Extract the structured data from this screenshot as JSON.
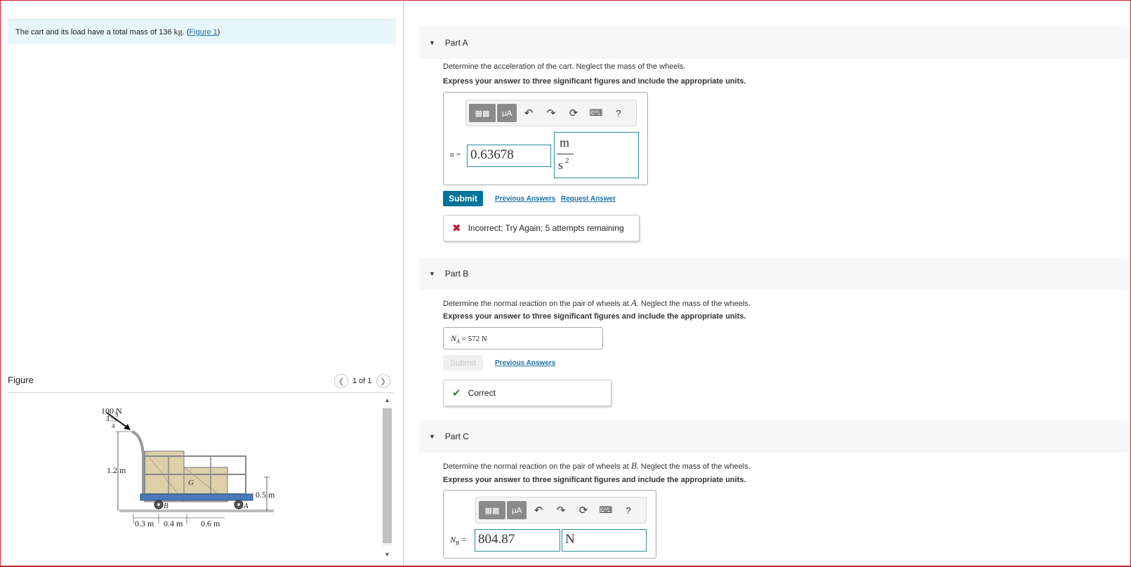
{
  "problem": {
    "text_before": "The cart and its load have a total mass of 136",
    "mass_unit": "kg",
    "text_after": ". (",
    "figure_link": "Figure 1",
    "text_end": ")"
  },
  "figure": {
    "label": "Figure",
    "pager": "1 of 1",
    "prev_icon": "chevron-left-icon",
    "next_icon": "chevron-right-icon",
    "labels": {
      "force": "100 N",
      "slope_3": "3",
      "slope_4": "4",
      "slope_5": "5",
      "height": "1.2 m",
      "wheel_height": "0.5 m",
      "point_g": "G",
      "point_b": "B",
      "point_a": "A",
      "dim_1": "0.3 m",
      "dim_2": "0.4 m",
      "dim_3": "0.6 m"
    }
  },
  "toolbar": {
    "template_icon": "template-icon",
    "units_label": "μA",
    "undo_icon": "undo-icon",
    "redo_icon": "redo-icon",
    "reset_icon": "reset-icon",
    "keyboard_icon": "keyboard-icon",
    "help_label": "?"
  },
  "parts": {
    "a": {
      "header": "Part A",
      "prompt": "Determine the acceleration of the cart. Neglect the mass of the wheels.",
      "instruction": "Express your answer to three significant figures and include the appropriate units.",
      "var_label": "a =",
      "value": "0.63678",
      "unit_numerator": "m",
      "unit_denominator": "s",
      "unit_exponent": "2",
      "submit": "Submit",
      "previous_answers": "Previous Answers",
      "request_answer": "Request Answer",
      "feedback": "Incorrect; Try Again; 5 attempts remaining",
      "feedback_color": "#c8102e"
    },
    "b": {
      "header": "Part B",
      "prompt_before": "Determine the normal reaction on the pair of wheels at",
      "point": "A",
      "prompt_after": ". Neglect the mass of the wheels.",
      "instruction": "Express your answer to three significant figures and include the appropriate units.",
      "var_label": "N",
      "var_subscript": "A",
      "answer": "= 572 N",
      "submit": "Submit",
      "previous_answers": "Previous Answers",
      "feedback": "Correct",
      "feedback_color": "#2e8b2e"
    },
    "c": {
      "header": "Part C",
      "prompt_before": "Determine the normal reaction on the pair of wheels at",
      "point": "B",
      "prompt_after": ". Neglect the mass of the wheels.",
      "instruction": "Express your answer to three significant figures and include the appropriate units.",
      "var_label": "N",
      "var_subscript": "B",
      "equals": "=",
      "value": "804.87",
      "unit": "N"
    }
  }
}
